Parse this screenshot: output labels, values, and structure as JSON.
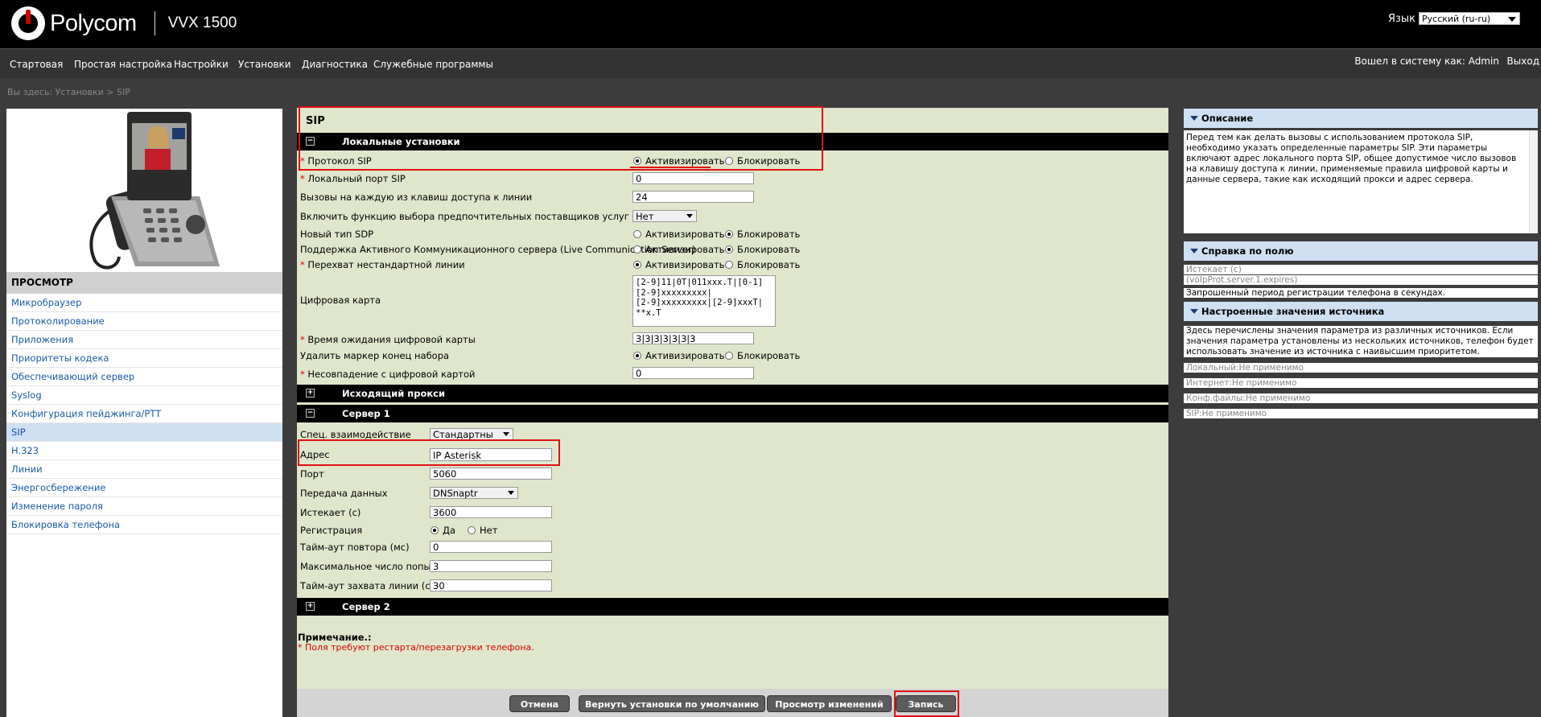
{
  "header": {
    "brand": "Polycom",
    "model": "VVX 1500",
    "language_label": "Язык",
    "language_value": "Русский (ru-ru)"
  },
  "nav": {
    "items": [
      "Стартовая",
      "Простая настройка",
      "Настройки",
      "Установки",
      "Диагностика",
      "Служебные программы"
    ],
    "login": "Вошел в систему как: Admin",
    "logout": "Выход"
  },
  "breadcrumb": "Вы здесь: Установки > SIP",
  "left": {
    "view_header": "ПРОСМОТР",
    "items": [
      "Микробраузер",
      "Протоколирование",
      "Приложения",
      "Приоритеты кодека",
      "Обеспечивающий сервер",
      "Syslog",
      "Конфигурация пейджинга/PTT",
      "SIP",
      "H.323",
      "Линии",
      "Энергосбережение",
      "Изменение пароля",
      "Блокировка телефона"
    ],
    "active_index": 7
  },
  "main": {
    "title": "SIP",
    "local": {
      "header": "Локальные установки",
      "sip_protocol": {
        "label": "Протокол SIP",
        "on": "Активизировать",
        "off": "Блокировать"
      },
      "local_port": {
        "label": "Локальный порт SIP",
        "value": "0"
      },
      "calls_per_key": {
        "label": "Вызовы на каждую из клавиш доступа к линии",
        "value": "24"
      },
      "roaming": {
        "label": "Включить функцию выбора предпочтительных поставщиков услуг роуминга",
        "value": "Нет"
      },
      "sdp": {
        "label": "Новый тип SDP",
        "on": "Активизировать",
        "off": "Блокировать"
      },
      "lcs": {
        "label": "Поддержка Активного Коммуникационного сервера (Live Communication Server)",
        "on": "Активизировать",
        "off": "Блокировать"
      },
      "intercept": {
        "label": "Перехват нестандартной  линии",
        "on": "Активизировать",
        "off": "Блокировать"
      },
      "digitmap": {
        "label": "Цифровая карта",
        "value": "[2-9]11|0T|011xxx.T|[0-1]\n[2-9]xxxxxxxxx|\n[2-9]xxxxxxxxx|[2-9]xxxT|\n**x.T"
      },
      "digitmap_timeout": {
        "label": "Время ожидания цифровой карты",
        "value": "3|3|3|3|3|3|3"
      },
      "remove_marker": {
        "label": "Удалить маркер конец набора",
        "on": "Активизировать",
        "off": "Блокировать"
      },
      "mismatch": {
        "label": "Несовпадение с цифровой картой",
        "value": "0"
      }
    },
    "outbound_header": "Исходящий прокси",
    "server1": {
      "header": "Сервер 1",
      "special": {
        "label": "Спец. взаимодействие",
        "value": "Стандартны"
      },
      "address": {
        "label": "Адрес",
        "value": "IP Asterisk"
      },
      "port": {
        "label": "Порт",
        "value": "5060"
      },
      "transport": {
        "label": "Передача данных",
        "value": "DNSnaptr"
      },
      "expires": {
        "label": "Истекает (с)",
        "value": "3600"
      },
      "register": {
        "label": "Регистрация",
        "yes": "Да",
        "no": "Нет"
      },
      "retry_timeout": {
        "label": "Тайм-аут повтора (мс)",
        "value": "0"
      },
      "max_retries": {
        "label": "Максимальное число попыток",
        "value": "3"
      },
      "line_seize": {
        "label": "Тайм-аут захвата линии (с)",
        "value": "30"
      }
    },
    "server2_header": "Сервер 2",
    "note_title": "Примечание.:",
    "note_text": "Поля требуют рестарта/перезагрузки телефона.",
    "buttons": {
      "cancel": "Отмена",
      "reset": "Вернуть установки по умолчанию",
      "view": "Просмотр изменений",
      "save": "Запись"
    }
  },
  "right": {
    "desc_header": "Описание",
    "desc_text": "Перед тем как делать вызовы с использованием протокола SIP, необходимо указать определенные параметры SIP. Эти параметры включают адрес локального порта SIP, общее допустимое число вызовов на клавишу доступа к линии, применяемые правила цифровой карты и данные сервера, такие как исходящий прокси и адрес сервера.",
    "field_header": "Справка по полю",
    "field_name": "Истекает (с)",
    "field_param": "(voIpProt.server.1.expires)",
    "field_desc": "Запрошенный период регистрации телефона в секундах.",
    "src_header": "Настроенные значения источника",
    "src_text": "Здесь перечислены значения параметра из различных источников. Если значения параметра установлены из нескольких источников, телефон будет использовать значение из источника с наивысшим приоритетом.",
    "src_local": "Локальный:Не применимо",
    "src_web": "Интернет:Не применимо",
    "src_conf": "Конф.файлы:Не применимо",
    "src_sip": "SIP:Не применимо"
  }
}
